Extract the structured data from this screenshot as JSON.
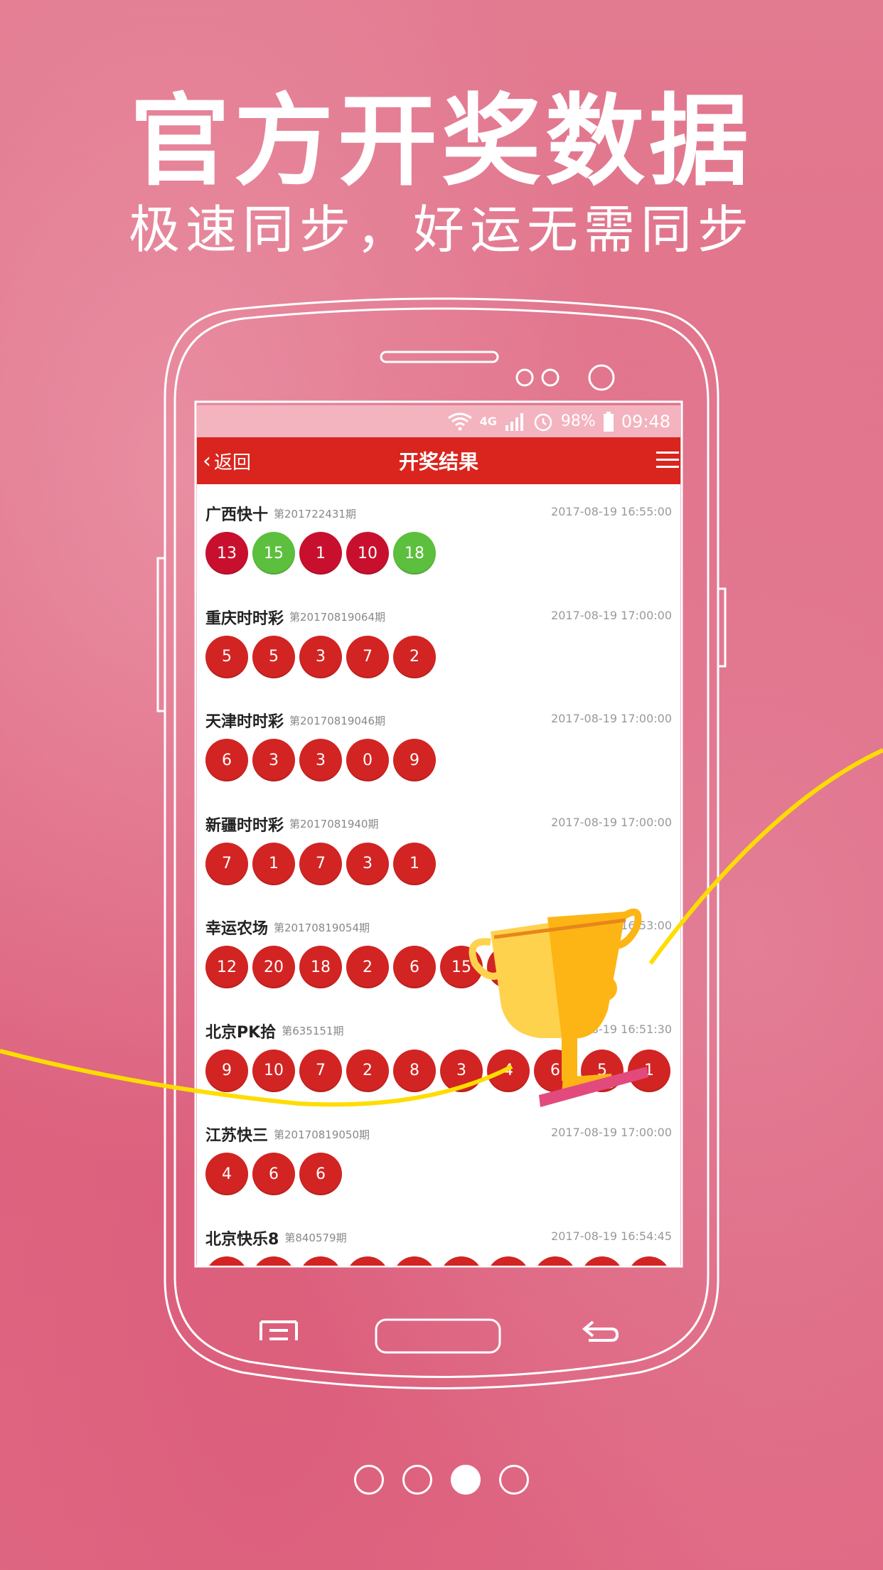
{
  "promo": {
    "headline": "官方开奖数据",
    "subline": "极速同步，好运无需同步"
  },
  "status_bar": {
    "network": "4G",
    "battery": "98%",
    "time": "09:48"
  },
  "app_bar": {
    "back_label": "返回",
    "title": "开奖结果"
  },
  "results": [
    {
      "name": "广西快十",
      "period": "第201722431期",
      "date": "2017-08-19 16:55:00",
      "balls": [
        {
          "n": "13",
          "c": "crimson"
        },
        {
          "n": "15",
          "c": "green"
        },
        {
          "n": "1",
          "c": "crimson"
        },
        {
          "n": "10",
          "c": "crimson"
        },
        {
          "n": "18",
          "c": "green"
        }
      ]
    },
    {
      "name": "重庆时时彩",
      "period": "第20170819064期",
      "date": "2017-08-19 17:00:00",
      "balls": [
        {
          "n": "5"
        },
        {
          "n": "5"
        },
        {
          "n": "3"
        },
        {
          "n": "7"
        },
        {
          "n": "2"
        }
      ]
    },
    {
      "name": "天津时时彩",
      "period": "第20170819046期",
      "date": "2017-08-19 17:00:00",
      "balls": [
        {
          "n": "6"
        },
        {
          "n": "3"
        },
        {
          "n": "3"
        },
        {
          "n": "0"
        },
        {
          "n": "9"
        }
      ]
    },
    {
      "name": "新疆时时彩",
      "period": "第2017081940期",
      "date": "2017-08-19 17:00:00",
      "balls": [
        {
          "n": "7"
        },
        {
          "n": "1"
        },
        {
          "n": "7"
        },
        {
          "n": "3"
        },
        {
          "n": "1"
        }
      ]
    },
    {
      "name": "幸运农场",
      "period": "第20170819054期",
      "date": "2017-08-19 16:53:00",
      "balls": [
        {
          "n": "12"
        },
        {
          "n": "20"
        },
        {
          "n": "18"
        },
        {
          "n": "2"
        },
        {
          "n": "6"
        },
        {
          "n": "15"
        },
        {
          "n": "7"
        }
      ]
    },
    {
      "name": "北京PK拾",
      "period": "第635151期",
      "date": "2017-08-19 16:51:30",
      "balls": [
        {
          "n": "9"
        },
        {
          "n": "10"
        },
        {
          "n": "7"
        },
        {
          "n": "2"
        },
        {
          "n": "8"
        },
        {
          "n": "3"
        },
        {
          "n": "4"
        },
        {
          "n": "6"
        },
        {
          "n": "5"
        },
        {
          "n": "1"
        }
      ]
    },
    {
      "name": "江苏快三",
      "period": "第20170819050期",
      "date": "2017-08-19 17:00:00",
      "balls": [
        {
          "n": "4"
        },
        {
          "n": "6"
        },
        {
          "n": "6"
        }
      ]
    },
    {
      "name": "北京快乐8",
      "period": "第840579期",
      "date": "2017-08-19 16:54:45",
      "balls": [
        {
          "n": ""
        },
        {
          "n": ""
        },
        {
          "n": ""
        },
        {
          "n": ""
        },
        {
          "n": ""
        },
        {
          "n": ""
        },
        {
          "n": ""
        },
        {
          "n": ""
        },
        {
          "n": ""
        },
        {
          "n": ""
        }
      ]
    }
  ],
  "pager": {
    "count": 4,
    "active_index": 2
  },
  "icons": [
    "wifi-icon",
    "signal-icon",
    "alarm-icon",
    "battery-icon",
    "chevron-left-icon",
    "menu-icon",
    "trophy-icon",
    "phone-menu-key-icon",
    "phone-back-key-icon"
  ],
  "colors": {
    "app_bar": "#d9251d",
    "ball_red": "#d22422",
    "ball_green": "#5cbf3d",
    "ball_crimson": "#c8102e",
    "ribbon": "#ffdd00"
  }
}
